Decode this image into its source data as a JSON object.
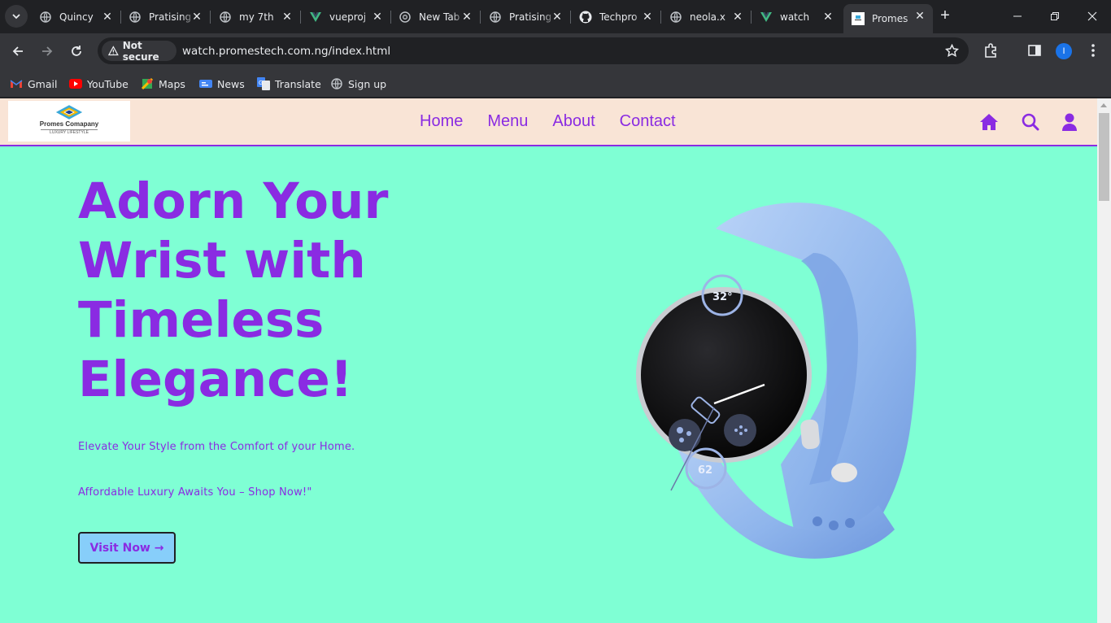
{
  "browser": {
    "tabs": [
      {
        "title": "Quincy",
        "icon": "globe-icon"
      },
      {
        "title": "Pratising",
        "icon": "globe-icon"
      },
      {
        "title": "my 7th",
        "icon": "globe-icon"
      },
      {
        "title": "vueproj",
        "icon": "vue-icon"
      },
      {
        "title": "New Tab",
        "icon": "chrome-icon"
      },
      {
        "title": "Pratising",
        "icon": "globe-icon"
      },
      {
        "title": "Techpro",
        "icon": "github-icon"
      },
      {
        "title": "neola.x",
        "icon": "globe-icon"
      },
      {
        "title": "watch",
        "icon": "vue-icon"
      },
      {
        "title": "Promes",
        "icon": "site-favicon",
        "active": true
      }
    ],
    "address": {
      "security_label": "Not secure",
      "url": "watch.promestech.com.ng/index.html"
    },
    "profile_initial": "I",
    "bookmarks": [
      {
        "label": "Gmail",
        "icon": "gmail-icon"
      },
      {
        "label": "YouTube",
        "icon": "youtube-icon"
      },
      {
        "label": "Maps",
        "icon": "maps-icon"
      },
      {
        "label": "News",
        "icon": "news-icon"
      },
      {
        "label": "Translate",
        "icon": "translate-icon"
      },
      {
        "label": "Sign up",
        "icon": "globe-icon"
      }
    ]
  },
  "site": {
    "logo": {
      "name": "Promes Comapany",
      "tagline": "LUXURY LIFESTYLE"
    },
    "nav": [
      "Home",
      "Menu",
      "About",
      "Contact"
    ],
    "hero": {
      "title": "Adorn Your Wrist with Timeless Elegance!",
      "subtitle1": "Elevate Your Style from the Comfort of your Home.",
      "subtitle2": "Affordable Luxury Awaits You – Shop Now!\"",
      "button": "Visit Now →",
      "watch_temp": "32°",
      "watch_heart": "62"
    },
    "colors": {
      "accent": "#8a2be2",
      "background": "#7fffd4",
      "header": "#f9e4d6",
      "button": "#87cefa"
    }
  }
}
